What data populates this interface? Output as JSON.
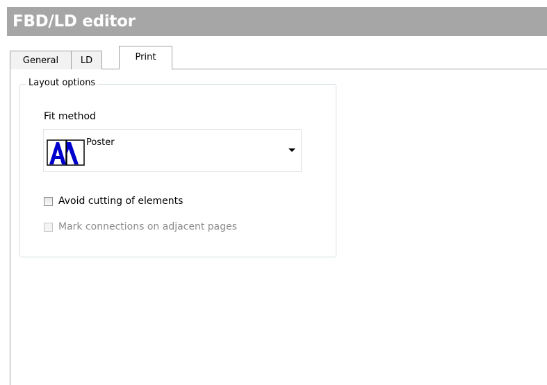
{
  "window": {
    "title": "FBD/LD editor"
  },
  "tabs": [
    {
      "label": "General",
      "active": false
    },
    {
      "label": "LD",
      "active": false
    },
    {
      "label": "Print",
      "active": true
    }
  ],
  "layout_options": {
    "group_title": "Layout options",
    "fit_method": {
      "label": "Fit method",
      "selected_value": "Poster",
      "icon": "poster-icon"
    },
    "checkboxes": [
      {
        "label": "Avoid cutting of elements",
        "checked": false,
        "enabled": true
      },
      {
        "label": "Mark connections on adjacent pages",
        "checked": false,
        "enabled": false
      }
    ]
  },
  "colors": {
    "title_bar_bg": "#a6a6a6",
    "title_text": "#ffffff",
    "icon_blue": "#0000cc",
    "disabled_text": "#8c8c8c"
  }
}
